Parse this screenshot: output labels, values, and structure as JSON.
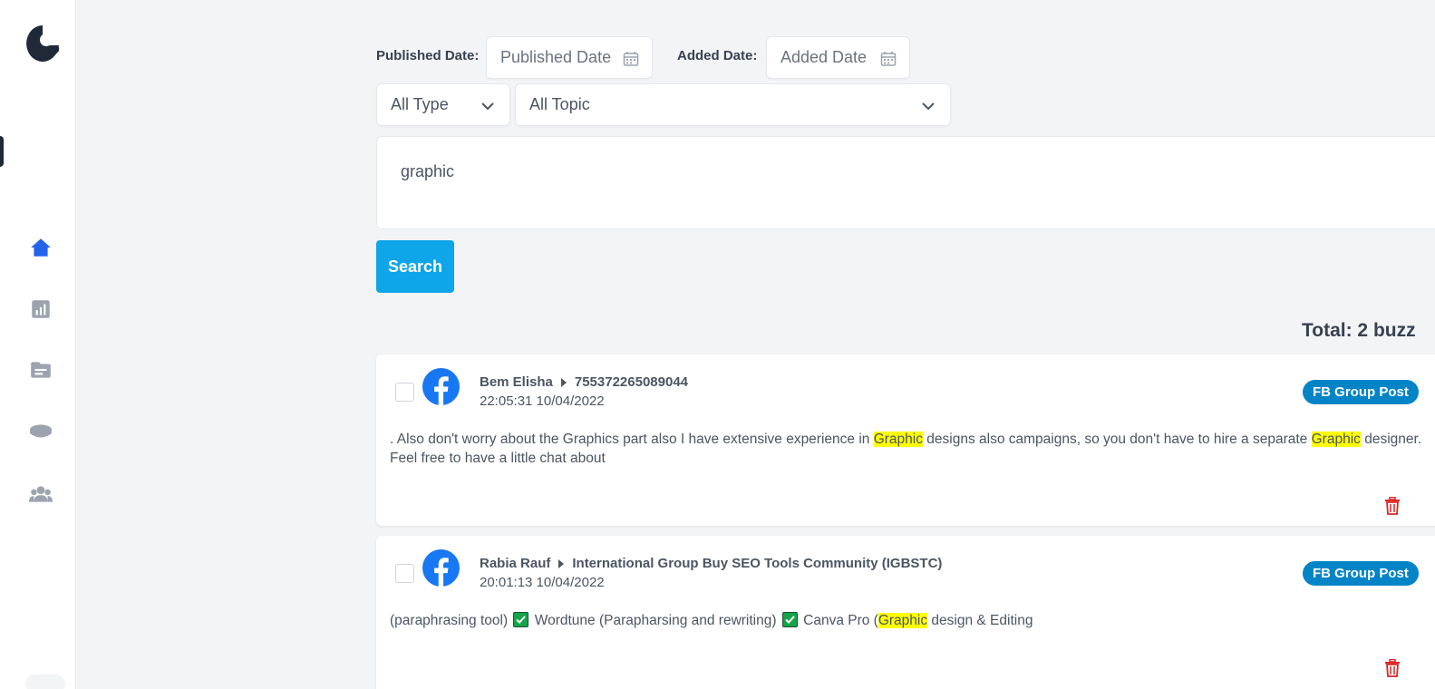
{
  "filters": {
    "published_label": "Published Date:",
    "published_placeholder": "Published Date",
    "added_label": "Added Date:",
    "added_placeholder": "Added Date",
    "type_value": "All Type",
    "topic_value": "All Topic",
    "query_value": "graphic",
    "search_label": "Search"
  },
  "summary": {
    "total": "Total: 2 buzz"
  },
  "posts": [
    {
      "author": "Bem Elisha",
      "group": "755372265089044",
      "time": "22:05:31 10/04/2022",
      "badge": "FB Group Post",
      "text_1": ". Also don't worry about the Graphics part also I have extensive experience in ",
      "hl_1": "Graphic",
      "text_2": " designs also campaigns, so you don't have to hire a separate ",
      "hl_2": "Graphic",
      "text_3": " designer. Feel free to have a little chat about"
    },
    {
      "author": "Rabia Rauf",
      "group": "International Group Buy SEO Tools Community (IGBSTC)",
      "time": "20:01:13 10/04/2022",
      "badge": "FB Group Post",
      "text_1": "(paraphrasing tool) ",
      "text_2": " Wordtune (Parapharsing and rewriting) ",
      "text_3": " Canva Pro (",
      "hl_1": "Graphic",
      "text_4": " design & Editing"
    }
  ],
  "colors": {
    "accent": "#0ea5e9",
    "badge": "#0284c7",
    "highlight": "#ffff00",
    "nav_active": "#2563eb",
    "delete": "#dc2626",
    "facebook": "#1877f2"
  },
  "icons": {
    "logo": "app-logo",
    "nav": [
      "home-icon",
      "chart-icon",
      "folder-icon",
      "database-icon",
      "users-icon"
    ],
    "calendar": "calendar-icon",
    "dropdown": "chevron-down-icon",
    "network": "facebook-icon",
    "delete": "trash-icon"
  }
}
